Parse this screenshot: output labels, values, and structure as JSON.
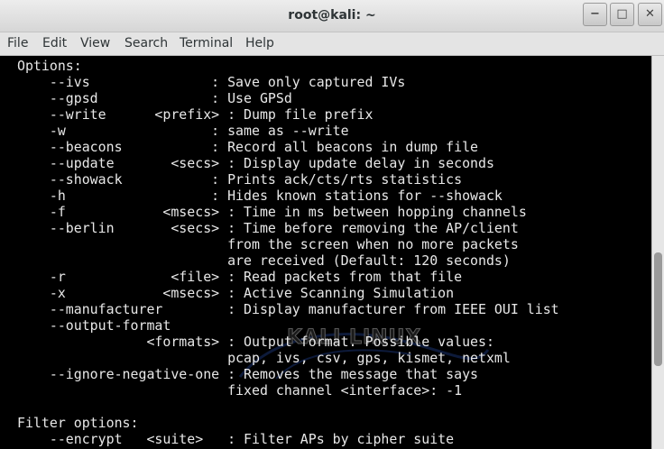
{
  "window": {
    "title": "root@kali: ~",
    "controls": {
      "minimize": "−",
      "maximize": "□",
      "close": "✕"
    }
  },
  "menu": {
    "file": "File",
    "edit": "Edit",
    "view": "View",
    "search": "Search",
    "terminal": "Terminal",
    "help": "Help"
  },
  "watermark": {
    "text": "KALI LINUX"
  },
  "terminal": {
    "lines": [
      "Options:",
      "    --ivs               : Save only captured IVs",
      "    --gpsd              : Use GPSd",
      "    --write      <prefix> : Dump file prefix",
      "    -w                  : same as --write",
      "    --beacons           : Record all beacons in dump file",
      "    --update       <secs> : Display update delay in seconds",
      "    --showack           : Prints ack/cts/rts statistics",
      "    -h                  : Hides known stations for --showack",
      "    -f            <msecs> : Time in ms between hopping channels",
      "    --berlin       <secs> : Time before removing the AP/client",
      "                          from the screen when no more packets",
      "                          are received (Default: 120 seconds)",
      "    -r             <file> : Read packets from that file",
      "    -x            <msecs> : Active Scanning Simulation",
      "    --manufacturer        : Display manufacturer from IEEE OUI list",
      "    --output-format",
      "                <formats> : Output format. Possible values:",
      "                          pcap, ivs, csv, gps, kismet, netxml",
      "    --ignore-negative-one : Removes the message that says",
      "                          fixed channel <interface>: -1",
      "",
      "Filter options:",
      "    --encrypt   <suite>   : Filter APs by cipher suite"
    ]
  }
}
